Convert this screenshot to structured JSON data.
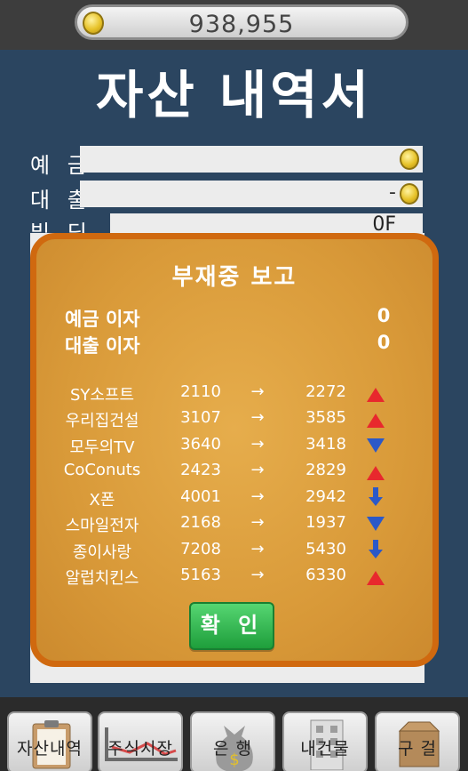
{
  "header": {
    "coins": "938,955"
  },
  "page": {
    "title": "자산 내역서"
  },
  "fields": {
    "deposit_label": "예 금",
    "loan_label": "대 출",
    "loan_value": "-",
    "building_label": "빌 딩",
    "building_value": "0F"
  },
  "report": {
    "title": "부재중 보고",
    "deposit_interest_label": "예금 이자",
    "deposit_interest_value": "0",
    "loan_interest_label": "대출 이자",
    "loan_interest_value": "0",
    "arrow_symbol": "→",
    "stocks": [
      {
        "name": "SY소프트",
        "from": "2110",
        "to": "2272",
        "trend": "up"
      },
      {
        "name": "우리집건설",
        "from": "3107",
        "to": "3585",
        "trend": "up"
      },
      {
        "name": "모두의TV",
        "from": "3640",
        "to": "3418",
        "trend": "down"
      },
      {
        "name": "CoConuts",
        "from": "2423",
        "to": "2829",
        "trend": "up"
      },
      {
        "name": "X폰",
        "from": "4001",
        "to": "2942",
        "trend": "big-down"
      },
      {
        "name": "스마일전자",
        "from": "2168",
        "to": "1937",
        "trend": "down"
      },
      {
        "name": "종이사랑",
        "from": "7208",
        "to": "5430",
        "trend": "big-down"
      },
      {
        "name": "알럽치킨스",
        "from": "5163",
        "to": "6330",
        "trend": "up"
      }
    ],
    "confirm_label": "확 인"
  },
  "nav": {
    "items": [
      {
        "label": "자산내역"
      },
      {
        "label": "주식시장"
      },
      {
        "label": "은 행"
      },
      {
        "label": "내건물"
      },
      {
        "label": "구 걸"
      }
    ]
  },
  "colors": {
    "background": "#2b4560",
    "dialog": "#d99a39",
    "dialog_border": "#d0690f",
    "up": "#e8282d",
    "down": "#2b59c8",
    "confirm": "#2fb34d"
  }
}
